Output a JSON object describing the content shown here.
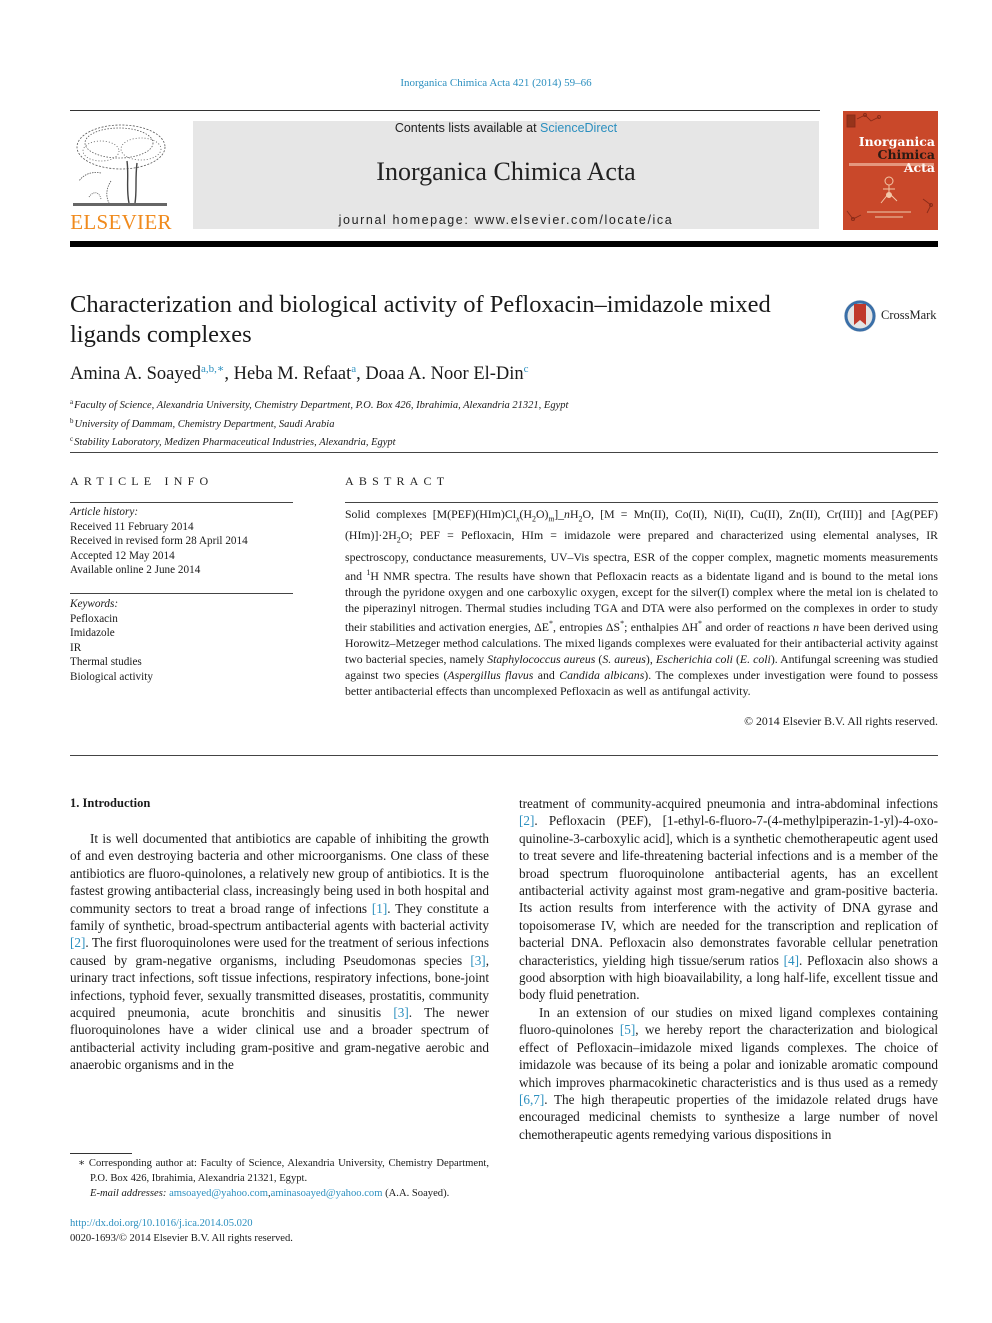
{
  "header": {
    "citation": "Inorganica Chimica Acta 421 (2014) 59–66",
    "contents_prefix": "Contents lists available at ",
    "contents_link": "ScienceDirect",
    "journal_title": "Inorganica Chimica Acta",
    "homepage": "journal homepage: www.elsevier.com/locate/ica",
    "publisher_wordmark": "ELSEVIER",
    "cover": {
      "line1": "Inorganica",
      "line2a": "Chimica",
      "line2b": "Acta"
    },
    "crossmark_label": "CrossMark"
  },
  "article": {
    "title": "Characterization and biological activity of Pefloxacin–imidazole mixed ligands complexes",
    "authors": [
      {
        "name": "Amina A. Soayed",
        "marks": "a,b,∗",
        "sep": ", "
      },
      {
        "name": "Heba M. Refaat",
        "marks": "a",
        "sep": ", "
      },
      {
        "name": "Doaa A. Noor El-Din",
        "marks": "c",
        "sep": ""
      }
    ],
    "affiliations": [
      {
        "mark": "a",
        "text": "Faculty of Science, Alexandria University, Chemistry Department, P.O. Box 426, Ibrahimia, Alexandria 21321, Egypt"
      },
      {
        "mark": "b",
        "text": "University of Dammam, Chemistry Department, Saudi Arabia"
      },
      {
        "mark": "c",
        "text": "Stability Laboratory, Medizen Pharmaceutical Industries, Alexandria, Egypt"
      }
    ]
  },
  "article_info": {
    "heading": "ARTICLE INFO",
    "history_label": "Article history:",
    "history": [
      "Received 11 February 2014",
      "Received in revised form 28 April 2014",
      "Accepted 12 May 2014",
      "Available online 2 June 2014"
    ],
    "keywords_label": "Keywords:",
    "keywords": [
      "Pefloxacin",
      "Imidazole",
      "IR",
      "Thermal studies",
      "Biological activity"
    ]
  },
  "abstract": {
    "heading": "ABSTRACT",
    "p1": "Solid complexes [M(PEF)(HIm)Cl",
    "x": "x",
    "p2": "(H",
    "two": "2",
    "p3": "O)",
    "m": "m",
    "p4": "]_",
    "n": "n",
    "p5": "H",
    "p6": "O, [M = Mn(II), Co(II), Ni(II), Cu(II), Zn(II), Cr(III)] and [Ag(PEF)(HIm)]·2H",
    "p7": "O; PEF = Pefloxacin, HIm = imidazole were prepared and characterized using elemental analyses, IR spectroscopy, conductance measurements, UV–Vis spectra, ESR of the copper complex, magnetic moments measurements and ",
    "one": "1",
    "p8": "H NMR spectra. The results have shown that Pefloxacin reacts as a bidentate ligand and is bound to the metal ions through the pyridone oxygen and one carboxylic oxygen, except for the silver(I) complex where the metal ion is chelated to the piperazinyl nitrogen. Thermal studies including TGA and DTA were also performed on the complexes in order to study their stabilities and activation energies, ΔE",
    "star": "*",
    "p9": ", entropies ΔS",
    "p10": "; enthalpies ΔH",
    "p11": " and order of reactions ",
    "p12": " have been derived using Horowitz–Metzeger method calculations. The mixed ligands complexes were evaluated for their antibacterial activity against two bacterial species, namely ",
    "sa": "Staphylococcus aureus",
    "p13": " (",
    "sa_short": "S. aureus",
    "p14": "), ",
    "ec": "Escherichia coli",
    "p15": " (",
    "ec_short": "E. coli",
    "p16": "). Antifungal screening was studied against two species (",
    "af": "Aspergillus flavus",
    "p17": " and ",
    "ca": "Candida albicans",
    "p18": "). The complexes under investigation were found to possess better antibacterial effects than uncomplexed Pefloxacin as well as antifungal activity.",
    "copyright": "© 2014 Elsevier B.V. All rights reserved."
  },
  "body": {
    "intro_heading": "1. Introduction",
    "left": {
      "t1": "It is well documented that antibiotics are capable of inhibiting the growth of and even destroying bacteria and other microorganisms. One class of these antibiotics are fluoro-quinolones, a relatively new group of antibiotics. It is the fastest growing antibacterial class, increasingly being used in both hospital and community sectors to treat a broad range of infections ",
      "r1": "[1]",
      "t2": ". They constitute a family of synthetic, broad-spectrum antibacterial agents with bacterial activity ",
      "r2": "[2]",
      "t3": ". The first fluoroquinolones were used for the treatment of serious infections caused by gram-negative organisms, including Pseudomonas species ",
      "r3": "[3]",
      "t4": ", urinary tract infections, soft tissue infections, respiratory infections, bone-joint infections, typhoid fever, sexually transmitted diseases, prostatitis, community acquired pneumonia, acute bronchitis and sinusitis ",
      "r4": "[3]",
      "t5": ". The newer fluoroquinolones have a wider clinical use and a broader spectrum of antibacterial activity including gram-positive and gram-negative aerobic and anaerobic organisms and in the"
    },
    "right": {
      "t1": "treatment of community-acquired pneumonia and intra-abdominal infections ",
      "r1": "[2]",
      "t2": ". Pefloxacin (PEF), [1-ethyl-6-fluoro-7-(4-methylpiperazin-1-yl)-4-oxo-quinoline-3-carboxylic acid], which is a synthetic chemotherapeutic agent used to treat severe and life-threatening bacterial infections and is a member of the broad spectrum fluoroquinolone antibacterial agents, has an excellent antibacterial activity against most gram-negative and gram-positive bacteria. Its action results from interference with the activity of DNA gyrase and topoisomerase IV, which are needed for the transcription and replication of bacterial DNA. Pefloxacin also demonstrates favorable cellular penetration characteristics, yielding high tissue/serum ratios ",
      "r2": "[4]",
      "t3": ". Pefloxacin also shows a good absorption with high bioavailability, a long half-life, excellent tissue and body fluid penetration.",
      "p2_t1": "In an extension of our studies on mixed ligand complexes containing fluoro-quinolones ",
      "p2_r1": "[5]",
      "p2_t2": ", we hereby report the characterization and biological effect of Pefloxacin–imidazole mixed ligands complexes. The choice of imidazole was because of its being a polar and ionizable aromatic compound which improves pharmacokinetic characteristics and is thus used as a remedy ",
      "p2_r2": "[6,7]",
      "p2_t3": ". The high therapeutic properties of the imidazole related drugs have encouraged medicinal chemists to synthesize a large number of novel chemotherapeutic agents remedying various dispositions in"
    }
  },
  "footnote": {
    "star": "∗",
    "corresponding": " Corresponding author at: Faculty of Science, Alexandria University, Chemistry Department, P.O. Box 426, Ibrahimia, Alexandria 21321, Egypt.",
    "email_label": "E-mail addresses: ",
    "email1": "amsoayed@yahoo.com",
    "email_sep": ",",
    "email2": "aminasoayed@yahoo.com",
    "email_owner": " (A.A. Soayed).",
    "doi": "http://dx.doi.org/10.1016/j.ica.2014.05.020",
    "issn": "0020-1693/© 2014 Elsevier B.V. All rights reserved."
  },
  "colors": {
    "link": "#2b8fbf",
    "elsevier_orange": "#f08a1c",
    "cover_red": "#c9482a",
    "masthead_gray": "#e6e6e6"
  }
}
